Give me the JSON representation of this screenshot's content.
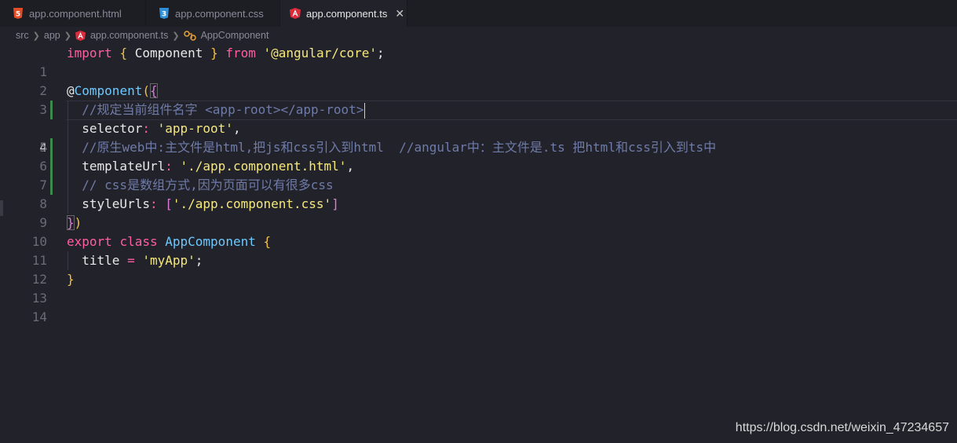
{
  "tabs": [
    {
      "label": "app.component.html",
      "icon": "html5-icon",
      "color": "#e44d26",
      "active": false
    },
    {
      "label": "app.component.css",
      "icon": "css3-icon",
      "color": "#2f8fd8",
      "active": false
    },
    {
      "label": "app.component.ts",
      "icon": "angular-icon",
      "color": "#dd2c3c",
      "active": true,
      "close": "✕"
    }
  ],
  "breadcrumb": {
    "parts": [
      "src",
      "app",
      "app.component.ts",
      "AppComponent"
    ]
  },
  "line_numbers": [
    "1",
    "2",
    "3",
    "4",
    "5",
    "6",
    "7",
    "8",
    "9",
    "10",
    "11",
    "12",
    "13",
    "14"
  ],
  "current_line": "4",
  "code": {
    "l1": {
      "t1": "import",
      "t2": "{",
      "t3": "Component",
      "t4": "}",
      "t5": "from",
      "t6": "'@angular/core'",
      "t7": ";"
    },
    "l3": {
      "t1": "@",
      "t2": "Component",
      "t3": "(",
      "t4": "{"
    },
    "l4": {
      "t1": "//规定当前组件名字 <app-root></app-root>"
    },
    "l5": {
      "t1": "selector",
      "t2": ":",
      "t3": "'app-root'",
      "t4": ","
    },
    "l6": {
      "t1": "//原生web中:主文件是html,把js和css引入到html  //angular中：主文件是.ts 把html和css引入到ts中"
    },
    "l7": {
      "t1": "templateUrl",
      "t2": ":",
      "t3": "'./app.component.html'",
      "t4": ","
    },
    "l8": {
      "t1": "// css是数组方式,因为页面可以有很多css"
    },
    "l9": {
      "t1": "styleUrls",
      "t2": ":",
      "t3": "[",
      "t4": "'./app.component.css'",
      "t5": "]"
    },
    "l10": {
      "t1": "}",
      "t2": ")"
    },
    "l11": {
      "t1": "export",
      "t2": "class",
      "t3": "AppComponent",
      "t4": "{"
    },
    "l12": {
      "t1": "title",
      "t2": "=",
      "t3": "'myApp'",
      "t4": ";"
    },
    "l13": {
      "t1": "}"
    }
  },
  "watermark": "https://blog.csdn.net/weixin_47234657"
}
